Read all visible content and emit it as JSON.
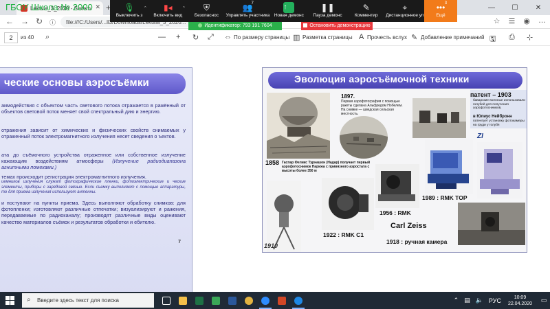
{
  "overlay_title": "ГБОУ Школа № 2000",
  "browser": {
    "tab_title": "Lektsia_3_2020 - Sistem",
    "tab_close": "✕",
    "tab_new": "+",
    "url": "file:///C:/Users/...ll3/Downloads/Lektsia_3_2020...",
    "min": "—",
    "max": "☐",
    "close": "✕"
  },
  "pdf_toolbar": {
    "page_value": "2",
    "page_of": "из 40",
    "fit_page": "По размеру страницы",
    "page_layout": "Разметка страницы",
    "read_aloud": "Прочесть вслух",
    "add_notes": "Добавление примечаний"
  },
  "zoom": {
    "mute": "Выключить з",
    "video": "Включить вид",
    "security": "Безопаснос",
    "participants": "Управлять участника",
    "participants_count": "7",
    "new_share": "Новая демонс",
    "pause_share": "Пауза демонс",
    "annotate": "Комментир",
    "remote": "Дистанционное уп",
    "more": "Ещё",
    "more_count": "3",
    "meeting_id": "Идентификатор: 793 191 7604",
    "stop_share": "Остановить демонстрацию"
  },
  "slide_left": {
    "title": "ческие основы аэросъёмки",
    "p1": "аимодействия с объектом часть светового потока отражается в ражённый от объектов световой поток меняет свой спектральный дию и энергию.",
    "p2": "отражения зависит от химических и физических свойств снимаемых у отраженный поток электромагнитного излучения несет сведения о ъектов.",
    "p3": "ата до съёмочного устройства отраженное или собственное излучение кажающим воздействиям атмосферы",
    "p3_italic": "(Излучение радиодиапазона агнитными помехами.)",
    "p4": "темах происходит регистрация электромагнитного излучения.",
    "p4_small": "иемников излучения служат фотографические пленки, фотоэлектрические и ческие элементы, приборы с зарядовой связью. Если съемку выполняют с помощью аппаратуры, то для приема излучения используют антенны.",
    "p5": "и поступают на пункты приема. Здесь выполняют обработку снимков: для фотопленки; изготовляют различные отпечатки; визуализируют и ражения, передаваемые по радиоканалу; производят различные виды оценивают качество материалов съёмок и результатов обработки и ебителю.",
    "page_number": "7"
  },
  "slide_right": {
    "title": "Эволюция аэросъёмочной техники",
    "year_1897": "1897.",
    "text_1897": "Первая аэрофотография с помощью ракеты сделана Альфредом Нобелем. На снимке — шведская сельская местность.",
    "patent_title": "патент – 1903",
    "patent_text": "баварские военные использовали голубей для получения аэрофотоснимков,",
    "patent_name": "в Юлиус Нейбронн",
    "patent_text2": "патентует установку фотокамеры на груди у голубя",
    "year_1858": "1858",
    "text_1858": "Гаспар Феликс Турнашон (Надар) получает первый аэрофотоснимок Парижа с привязного аэростата с высоты более 350 м",
    "rmk_top": "1989 : RMK TOP",
    "rmk_1956": "1956 : RMK",
    "rmk_c1": "1922 : RMK C1",
    "carl_zeiss": "Carl Zeiss",
    "camera_1918": "1918 : ручная камера",
    "year_1910": "1910",
    "zi_logo": "ZI"
  },
  "taskbar": {
    "search_placeholder": "Введите здесь текст для поиска",
    "lang": "РУС",
    "time": "10:09",
    "date": "22.04.2020"
  }
}
